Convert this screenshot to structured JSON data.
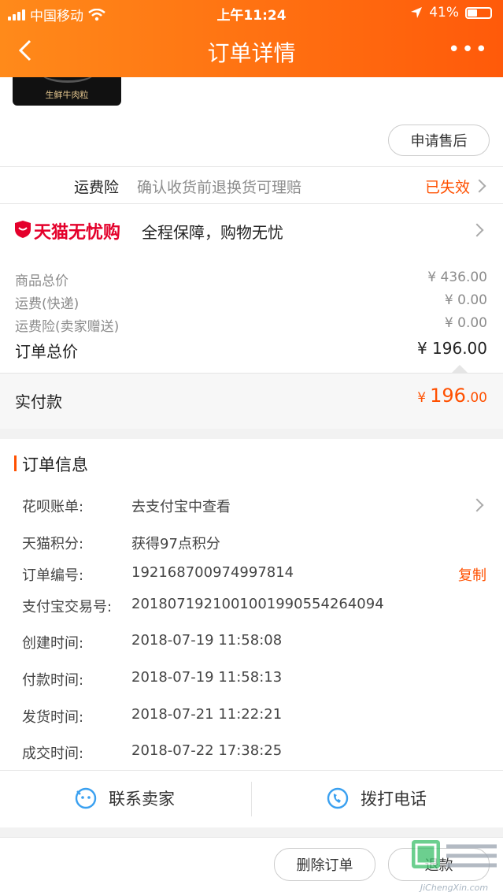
{
  "status_bar": {
    "carrier": "中国移动",
    "time": "上午11:24",
    "battery": "41%"
  },
  "nav": {
    "title": "订单详情",
    "more": "•••"
  },
  "product": {
    "image_text": "生鲜牛肉粒"
  },
  "actions": {
    "after_sale": "申请售后"
  },
  "insurance": {
    "label": "运费险",
    "desc": "确认收货前退换货可理赔",
    "status": "已失效"
  },
  "guarantee": {
    "brand": "天猫无忧购",
    "desc": "全程保障，购物无忧"
  },
  "price": {
    "goods_label": "商品总价",
    "goods_value": "¥ 436.00",
    "shipping_label": "运费(快递)",
    "shipping_value": "¥ 0.00",
    "ins_label": "运费险(卖家赠送)",
    "ins_value": "¥ 0.00",
    "total_label": "订单总价",
    "total_value": "¥ 196.00",
    "paid_label": "实付款",
    "paid_symbol": "¥",
    "paid_int": "196",
    "paid_dec": ".00"
  },
  "order_info": {
    "title": "订单信息",
    "rows": [
      {
        "label": "花呗账单:",
        "value": "去支付宝中查看"
      },
      {
        "label": "天猫积分:",
        "value": "获得97点积分"
      },
      {
        "label": "订单编号:",
        "value": "192168700974997814"
      },
      {
        "label": "支付宝交易号:",
        "value": "2018071921001001990554264094"
      },
      {
        "label": "创建时间:",
        "value": "2018-07-19 11:58:08"
      },
      {
        "label": "付款时间:",
        "value": "2018-07-19 11:58:13"
      },
      {
        "label": "发货时间:",
        "value": "2018-07-21 11:22:21"
      },
      {
        "label": "成交时间:",
        "value": "2018-07-22 17:38:25"
      }
    ],
    "copy": "复制"
  },
  "contact": {
    "seller": "联系卖家",
    "phone": "拨打电话"
  },
  "bottom": {
    "delete": "删除订单",
    "refund": "退款"
  },
  "watermark": {
    "text": "JiChengXin.com"
  },
  "colors": {
    "accent": "#ff5000",
    "header_start": "#ff8a1a",
    "header_end": "#ff5a0a",
    "tmall_red": "#e4002b"
  }
}
